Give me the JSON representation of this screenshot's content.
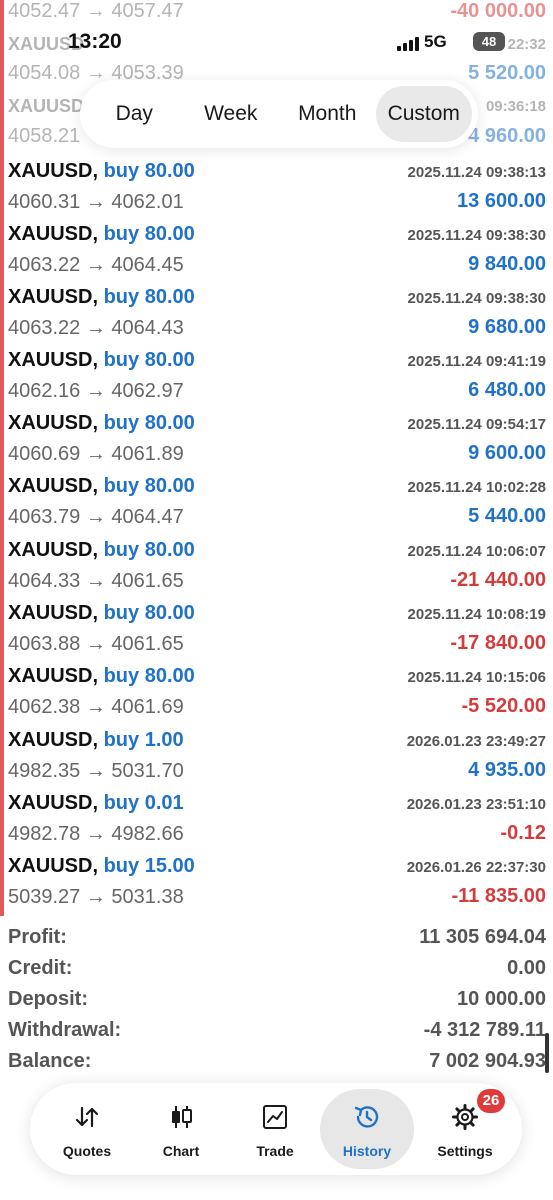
{
  "status_bar": {
    "time": "13:20",
    "network": "5G",
    "battery": "48"
  },
  "ghost_rows": [
    {
      "prices": "4052.47 → 4057.47",
      "profit": "-40 000.00",
      "sign": "neg"
    },
    {
      "symbol": "XAUUSD",
      "time": "22:32"
    },
    {
      "prices": "4054.08 → 4053.39",
      "profit": "5 520.00",
      "sign": "pos"
    },
    {
      "symbol": "XAUUSD",
      "time": "09:36:18"
    },
    {
      "prices": "4058.21",
      "profit": "4 960.00",
      "sign": "pos"
    }
  ],
  "period_tabs": {
    "day": "Day",
    "week": "Week",
    "month": "Month",
    "custom": "Custom"
  },
  "trades": [
    {
      "symbol": "XAUUSD,",
      "direction": "buy 80.00",
      "time": "2025.11.24 09:38:13",
      "prices": "4060.31 → 4062.01",
      "profit": "13 600.00",
      "sign": "pos"
    },
    {
      "symbol": "XAUUSD,",
      "direction": "buy 80.00",
      "time": "2025.11.24 09:38:30",
      "prices": "4063.22 → 4064.45",
      "profit": "9 840.00",
      "sign": "pos"
    },
    {
      "symbol": "XAUUSD,",
      "direction": "buy 80.00",
      "time": "2025.11.24 09:38:30",
      "prices": "4063.22 → 4064.43",
      "profit": "9 680.00",
      "sign": "pos"
    },
    {
      "symbol": "XAUUSD,",
      "direction": "buy 80.00",
      "time": "2025.11.24 09:41:19",
      "prices": "4062.16 → 4062.97",
      "profit": "6 480.00",
      "sign": "pos"
    },
    {
      "symbol": "XAUUSD,",
      "direction": "buy 80.00",
      "time": "2025.11.24 09:54:17",
      "prices": "4060.69 → 4061.89",
      "profit": "9 600.00",
      "sign": "pos"
    },
    {
      "symbol": "XAUUSD,",
      "direction": "buy 80.00",
      "time": "2025.11.24 10:02:28",
      "prices": "4063.79 → 4064.47",
      "profit": "5 440.00",
      "sign": "pos"
    },
    {
      "symbol": "XAUUSD,",
      "direction": "buy 80.00",
      "time": "2025.11.24 10:06:07",
      "prices": "4064.33 → 4061.65",
      "profit": "-21 440.00",
      "sign": "neg"
    },
    {
      "symbol": "XAUUSD,",
      "direction": "buy 80.00",
      "time": "2025.11.24 10:08:19",
      "prices": "4063.88 → 4061.65",
      "profit": "-17 840.00",
      "sign": "neg"
    },
    {
      "symbol": "XAUUSD,",
      "direction": "buy 80.00",
      "time": "2025.11.24 10:15:06",
      "prices": "4062.38 → 4061.69",
      "profit": "-5 520.00",
      "sign": "neg"
    },
    {
      "symbol": "XAUUSD,",
      "direction": "buy 1.00",
      "time": "2026.01.23 23:49:27",
      "prices": "4982.35 → 5031.70",
      "profit": "4 935.00",
      "sign": "pos"
    },
    {
      "symbol": "XAUUSD,",
      "direction": "buy 0.01",
      "time": "2026.01.23 23:51:10",
      "prices": "4982.78 → 4982.66",
      "profit": "-0.12",
      "sign": "neg"
    },
    {
      "symbol": "XAUUSD,",
      "direction": "buy 15.00",
      "time": "2026.01.26 22:37:30",
      "prices": "5039.27 → 5031.38",
      "profit": "-11 835.00",
      "sign": "neg"
    }
  ],
  "summary": [
    {
      "label": "Profit:",
      "value": "11 305 694.04"
    },
    {
      "label": "Credit:",
      "value": "0.00"
    },
    {
      "label": "Deposit:",
      "value": "10 000.00"
    },
    {
      "label": "Withdrawal:",
      "value": "-4 312 789.11"
    },
    {
      "label": "Balance:",
      "value": "7 002 904.93"
    }
  ],
  "nav": {
    "quotes": "Quotes",
    "chart": "Chart",
    "trade": "Trade",
    "history": "History",
    "settings": "Settings",
    "settings_badge": "26",
    "active": "history",
    "icons": {
      "quotes": "sort-arrows-icon",
      "chart": "candlestick-icon",
      "trade": "line-chart-icon",
      "history": "history-clock-icon",
      "settings": "gear-icon"
    }
  },
  "colors": {
    "profit_positive": "#1f72c8",
    "profit_negative": "#d43c3c",
    "accent": "#1f72c8",
    "badge": "#e03b3b"
  }
}
